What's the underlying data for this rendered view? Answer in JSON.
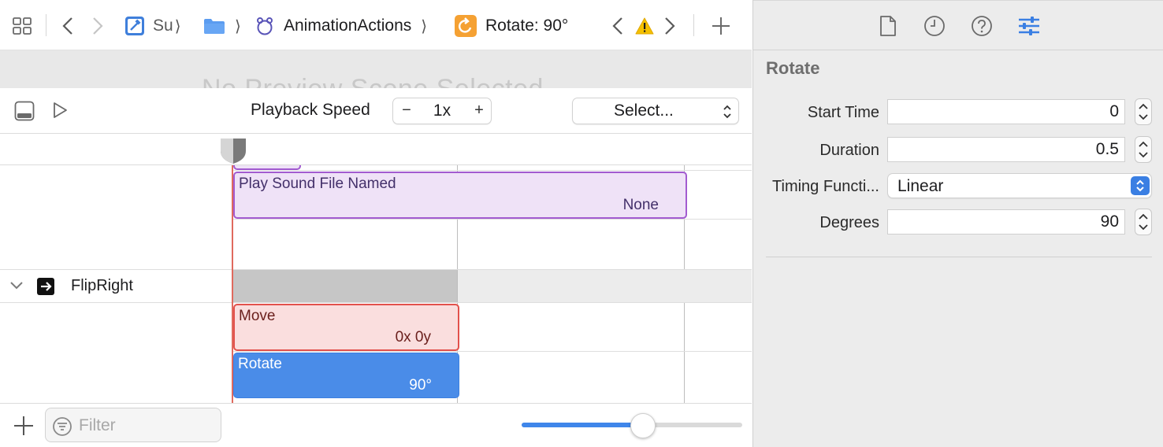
{
  "jumpbar": {
    "crumbs": [
      {
        "label": "Su",
        "icon": "xcode-project-icon"
      },
      {
        "label": "",
        "icon": "folder-icon"
      },
      {
        "label": "AnimationActions",
        "icon": "action-file-icon"
      },
      {
        "label": "Rotate: 90°",
        "icon": "rotate-action-icon"
      }
    ],
    "warning_icon": "warning-triangle-icon"
  },
  "preview": {
    "placeholder": "No Preview Scene Selected"
  },
  "timeline_toolbar": {
    "playback_speed_label": "Playback Speed",
    "speed_minus": "−",
    "speed_value": "1x",
    "speed_plus": "+",
    "scene_select_label": "Select..."
  },
  "tracks": {
    "sound_block": {
      "title": "Play Sound File Named",
      "value": "None"
    },
    "flipright_label": "FlipRight",
    "move_block": {
      "title": "Move",
      "value": "0x 0y"
    },
    "rotate_block": {
      "title": "Rotate",
      "value": "90°"
    }
  },
  "bottom_bar": {
    "filter_placeholder": "Filter",
    "zoom_level": 0.55
  },
  "inspector": {
    "title": "Rotate",
    "fields": {
      "start_time": {
        "label": "Start Time",
        "value": "0"
      },
      "duration": {
        "label": "Duration",
        "value": "0.5"
      },
      "timing_function": {
        "label": "Timing Functi...",
        "value": "Linear"
      },
      "degrees": {
        "label": "Degrees",
        "value": "90"
      }
    }
  },
  "colors": {
    "accent_blue": "#4a8ce8",
    "sound_fill": "#efe2f7",
    "sound_border": "#a25bd0",
    "move_fill": "#fadede",
    "move_border": "#e2514c",
    "rotate_fill": "#4a8ce8",
    "playhead_red": "#e06a5e",
    "warning_yellow": "#f4c000",
    "rotate_icon_orange": "#f5a133"
  }
}
